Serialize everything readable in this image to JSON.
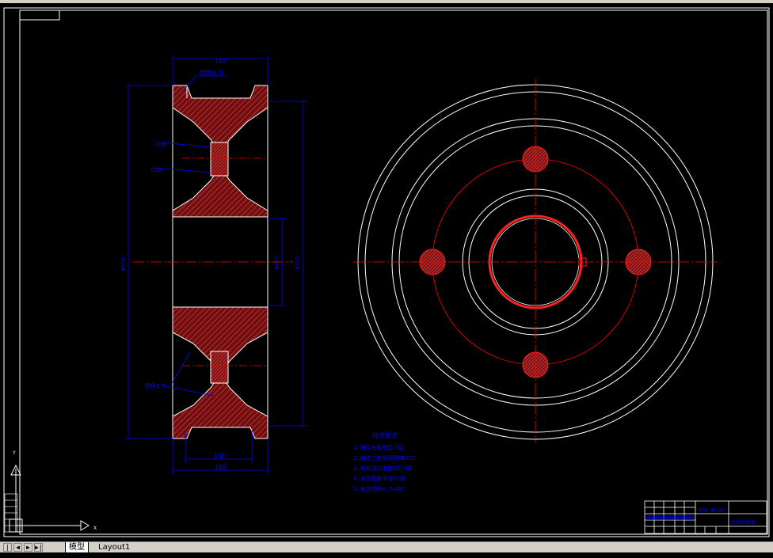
{
  "drawing": {
    "dimensions": {
      "top_width": "190",
      "bottom_inner_width": "130",
      "bottom_width": "190",
      "outer_diameter": "Φ580",
      "inner_diameter": "Φ475",
      "pitch_diameter": "Φ505",
      "chamfer_top": "倒角1.5",
      "chamfer_bottom": "倒角1.5",
      "fillet_upper": "R10",
      "fillet_lower": "R10"
    },
    "notes": {
      "title": "技术要求",
      "items": [
        "1.铸件去毛刺及飞边",
        "2.铸造工序需调质HB235",
        "3.未标注公差按IT14级",
        "4.未注圆角半径R5级",
        "5.未注倒角0.5×45°"
      ]
    },
    "title_block": {
      "material": "材料 HT200",
      "part_name": "驱动滑轮图"
    },
    "ucs": {
      "x_label": "X",
      "y_label": "Y"
    }
  },
  "layout_tabs": {
    "nav_buttons": [
      "|◀",
      "◀",
      "▶",
      "▶|"
    ],
    "tabs": [
      {
        "label": "模型",
        "active": true
      },
      {
        "label": "Layout1",
        "active": false
      }
    ]
  },
  "colors": {
    "background": "#000000",
    "outline": "#ffffff",
    "hatch": "#d42020",
    "center_line": "#ff0000",
    "dimension": "#0000ff"
  }
}
